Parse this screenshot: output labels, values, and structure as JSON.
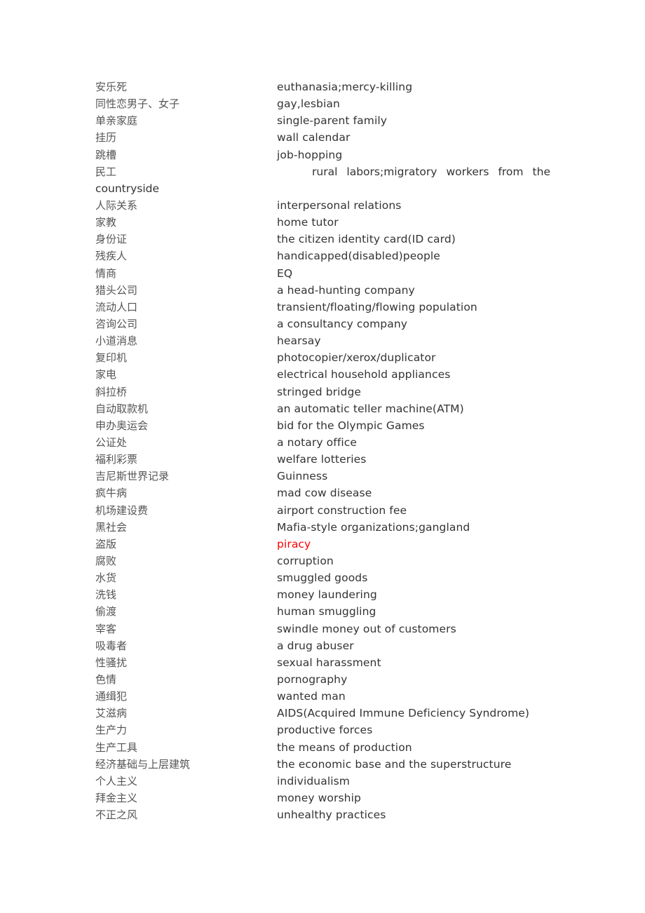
{
  "document": {
    "entries": [
      {
        "zh": "安乐死",
        "en": "euthanasia;mercy-killing"
      },
      {
        "zh": "同性恋男子、女子",
        "en": "gay,lesbian"
      },
      {
        "zh": "单亲家庭",
        "en": "single-parent family"
      },
      {
        "zh": "挂历",
        "en": "wall calendar"
      },
      {
        "zh": "跳槽",
        "en": "job-hopping"
      },
      {
        "zh": "民工",
        "en_line1": "rural labors;migratory workers from the",
        "en_line2": "countryside"
      },
      {
        "zh": "人际关系",
        "en": "interpersonal relations"
      },
      {
        "zh": "家教",
        "en": "home tutor"
      },
      {
        "zh": "身份证",
        "en": "the citizen identity card(ID card)"
      },
      {
        "zh": "残疾人",
        "en": "handicapped(disabled)people"
      },
      {
        "zh": "情商",
        "en": "EQ"
      },
      {
        "zh": "猎头公司",
        "en": "a head-hunting company"
      },
      {
        "zh": "流动人口",
        "en": "transient/floating/flowing population"
      },
      {
        "zh": "咨询公司",
        "en": "a consultancy company"
      },
      {
        "zh": "小道消息",
        "en": "hearsay"
      },
      {
        "zh": "复印机",
        "en": "photocopier/xerox/duplicator"
      },
      {
        "zh": "家电",
        "en": "electrical household appliances"
      },
      {
        "zh": "斜拉桥",
        "en": "stringed bridge"
      },
      {
        "zh": "自动取款机",
        "en": "an automatic teller machine(ATM)"
      },
      {
        "zh": "申办奥运会",
        "en": "bid for the Olympic Games"
      },
      {
        "zh": "公证处",
        "en": "a notary office"
      },
      {
        "zh": "福利彩票",
        "en": "welfare lotteries"
      },
      {
        "zh": "吉尼斯世界记录",
        "en": "Guinness"
      },
      {
        "zh": "疯牛病",
        "en": "mad cow disease"
      },
      {
        "zh": "机场建设费",
        "en": "airport construction fee"
      },
      {
        "zh": "黑社会",
        "en": "Mafia-style organizations;gangland"
      },
      {
        "zh": "盗版",
        "en": "piracy",
        "highlight": true
      },
      {
        "zh": "腐败",
        "en": "corruption"
      },
      {
        "zh": "水货",
        "en": "smuggled goods"
      },
      {
        "zh": "洗钱",
        "en": "money laundering"
      },
      {
        "zh": "偷渡",
        "en": "human smuggling"
      },
      {
        "zh": "宰客",
        "en": "swindle money out of customers"
      },
      {
        "zh": "吸毒者",
        "en": "a drug abuser"
      },
      {
        "zh": "性骚扰",
        "en": "sexual harassment"
      },
      {
        "zh": "色情",
        "en": "pornography"
      },
      {
        "zh": "通缉犯",
        "en": "wanted man"
      },
      {
        "zh": "艾滋病",
        "en": "AIDS(Acquired Immune Deficiency Syndrome)"
      },
      {
        "zh": "生产力",
        "en": "productive forces"
      },
      {
        "zh": "生产工具",
        "en": "the means of production"
      },
      {
        "zh": "经济基础与上层建筑",
        "en": "the economic base and the superstructure"
      },
      {
        "zh": "个人主义",
        "en": "individualism"
      },
      {
        "zh": "拜金主义",
        "en": "money worship"
      },
      {
        "zh": "不正之风",
        "en": "unhealthy practices"
      }
    ]
  },
  "colors": {
    "chinese_text": "#555555",
    "english_text": "#333333",
    "highlight_text": "#ff0000",
    "background": "#ffffff"
  }
}
